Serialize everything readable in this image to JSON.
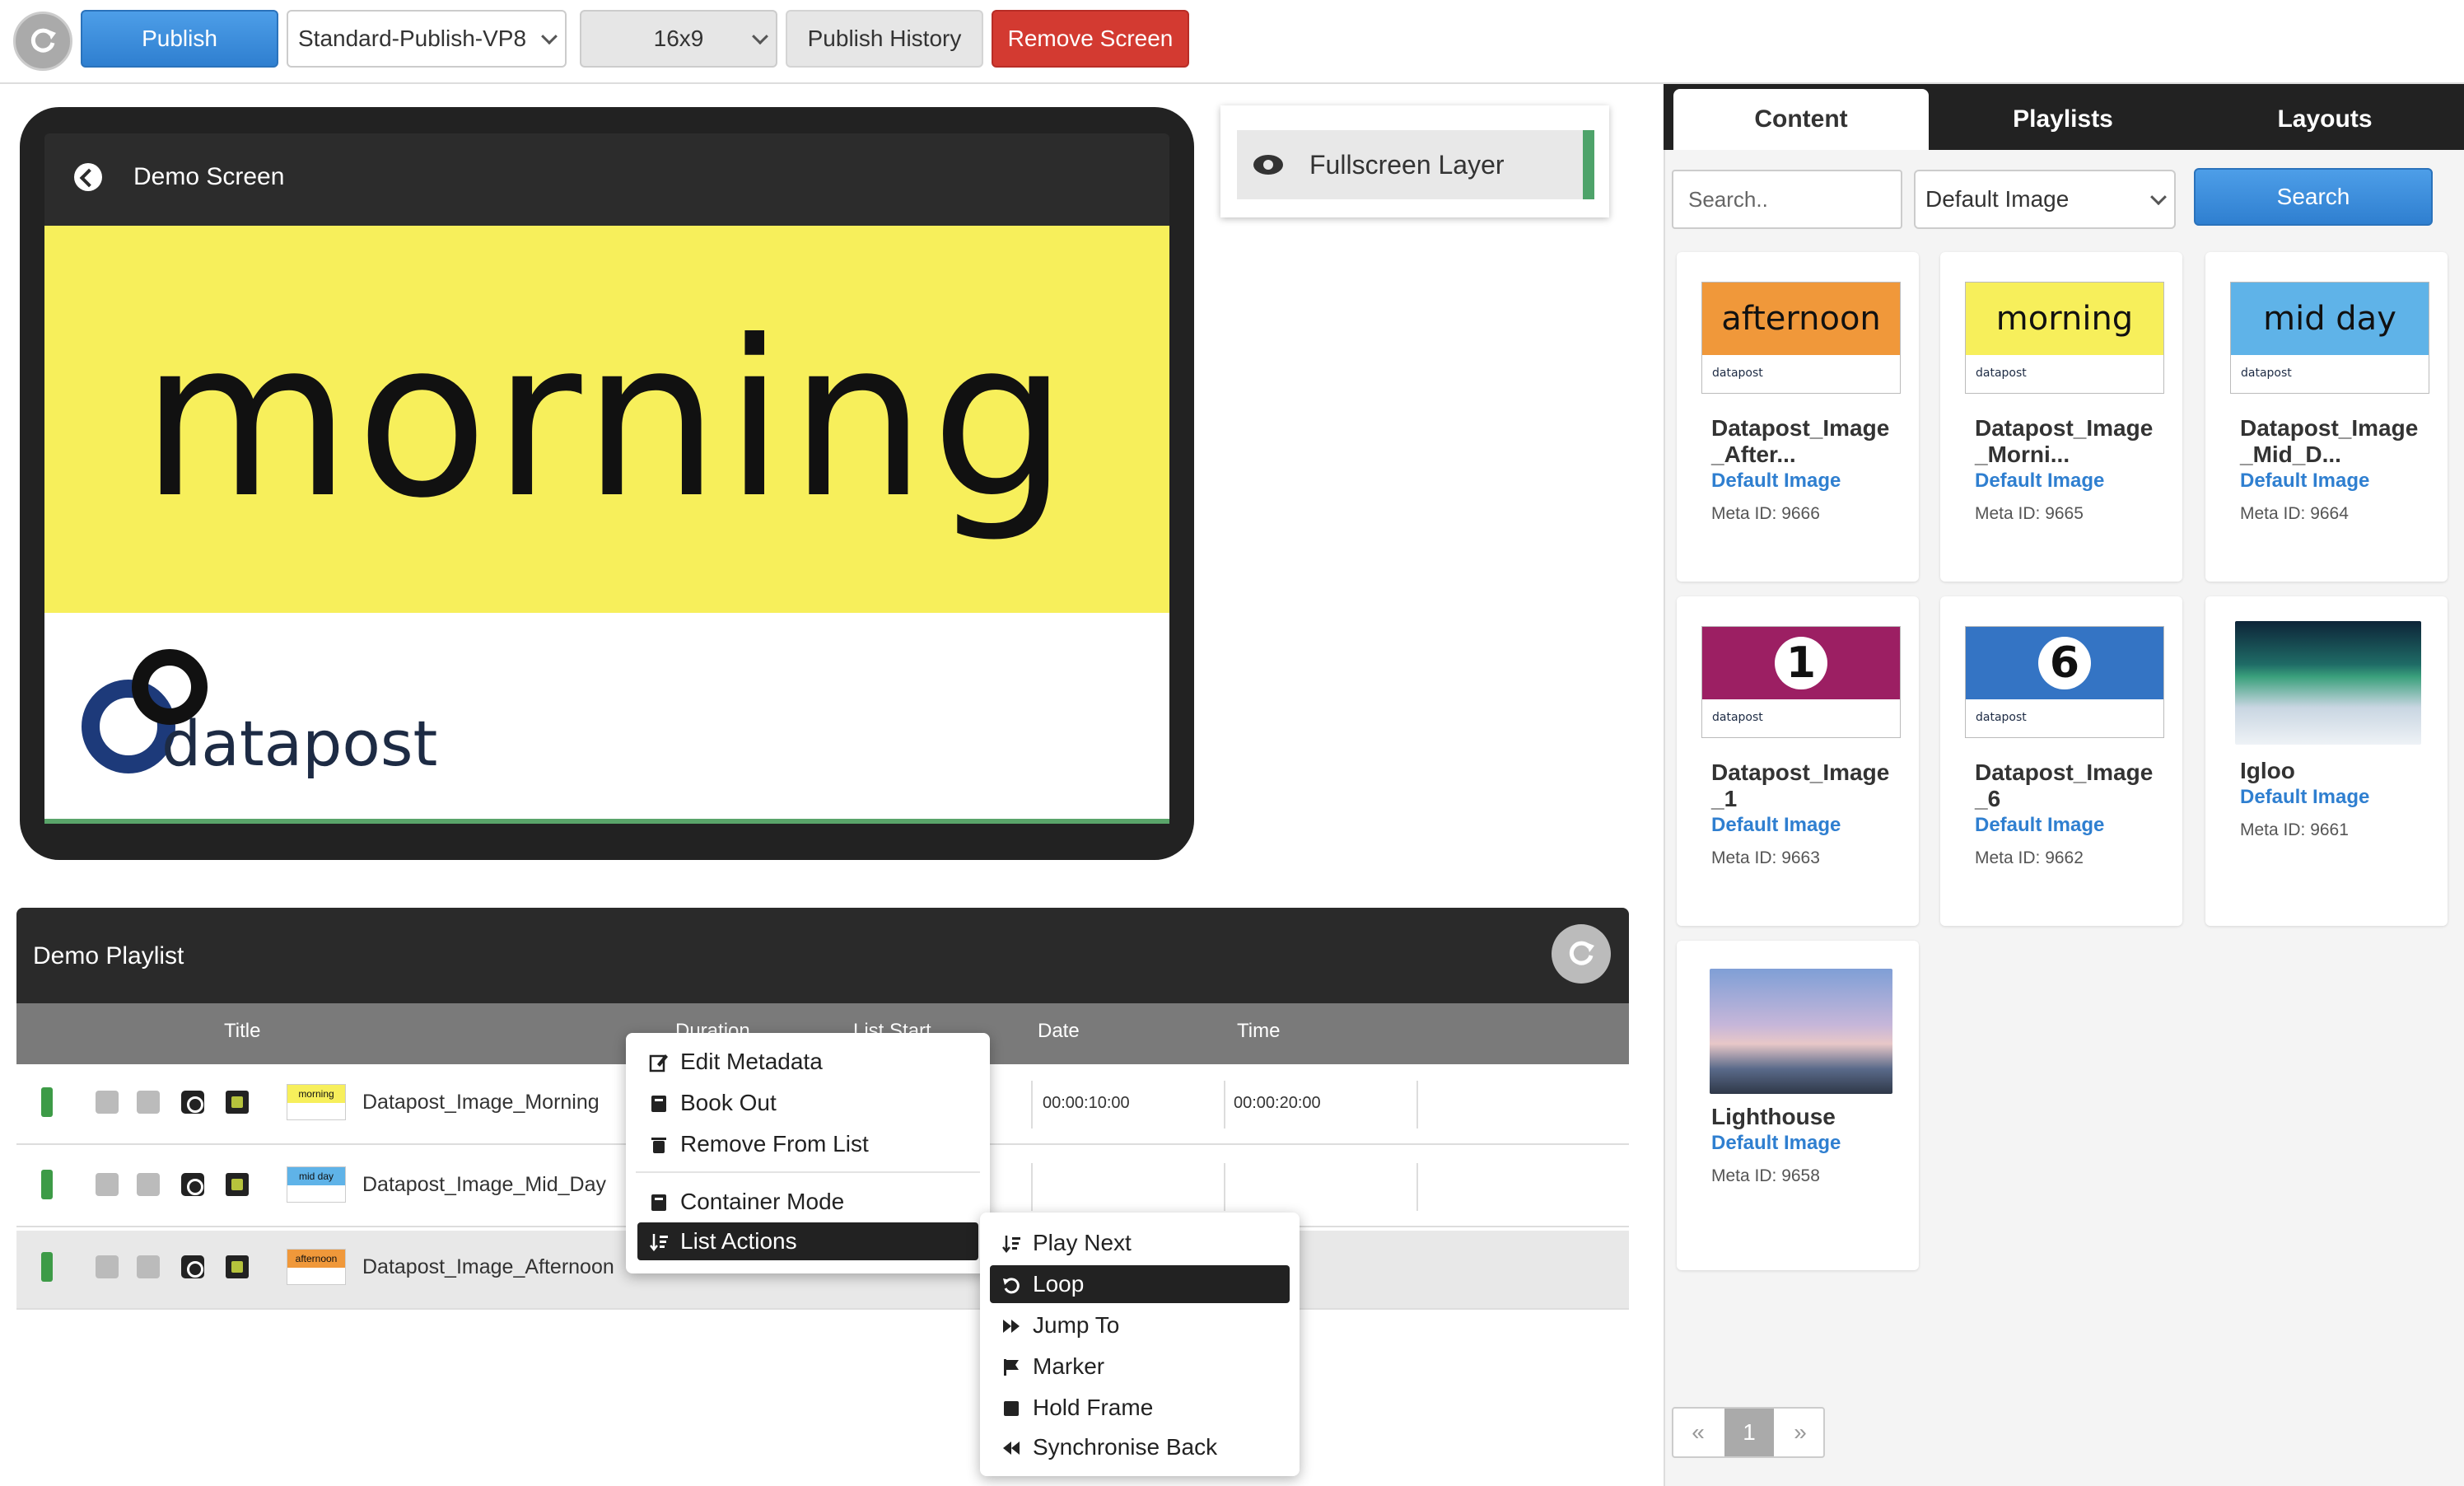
{
  "toolbar": {
    "publish_label": "Publish",
    "profile_value": "Standard-Publish-VP8",
    "ratio_value": "16x9",
    "history_label": "Publish History",
    "remove_label": "Remove Screen"
  },
  "preview": {
    "screen_title": "Demo Screen",
    "content_word": "morning",
    "logo_text": "datapost"
  },
  "layer": {
    "label": "Fullscreen Layer"
  },
  "playlist": {
    "title": "Demo Playlist",
    "columns": [
      "Title",
      "Duration",
      "List Start",
      "Date",
      "Time"
    ],
    "rows": [
      {
        "title": "Datapost_Image_Morning",
        "thumb": "morning",
        "date": "00:00:10:00",
        "time": "00:00:20:00"
      },
      {
        "title": "Datapost_Image_Mid_Day",
        "thumb": "mid day",
        "date": "",
        "time": ""
      },
      {
        "title": "Datapost_Image_Afternoon",
        "thumb": "afternoon",
        "date": "",
        "time": ""
      }
    ]
  },
  "context_menu": {
    "items": [
      "Edit Metadata",
      "Book Out",
      "Remove From List",
      "Container Mode",
      "List Actions"
    ],
    "submenu": [
      "Play Next",
      "Loop",
      "Jump To",
      "Marker",
      "Hold Frame",
      "Synchronise Back"
    ]
  },
  "right_panel": {
    "tabs": [
      "Content",
      "Playlists",
      "Layouts"
    ],
    "search_placeholder": "Search..",
    "filter_value": "Default Image",
    "search_button": "Search",
    "cards": [
      {
        "title": "Datapost_Image _After...",
        "type": "Default Image",
        "meta": "Meta ID: 9666",
        "thumb_text": "afternoon",
        "color": "#f0983a"
      },
      {
        "title": "Datapost_Image _Morni...",
        "type": "Default Image",
        "meta": "Meta ID: 9665",
        "thumb_text": "morning",
        "color": "#f7ef5b"
      },
      {
        "title": "Datapost_Image _Mid_D...",
        "type": "Default Image",
        "meta": "Meta ID: 9664",
        "thumb_text": "mid day",
        "color": "#5fb3e8"
      },
      {
        "title": "Datapost_Image _1",
        "type": "Default Image",
        "meta": "Meta ID: 9663",
        "thumb_text": "1",
        "color": "#9c1f63"
      },
      {
        "title": "Datapost_Image _6",
        "type": "Default Image",
        "meta": "Meta ID: 9662",
        "thumb_text": "6",
        "color": "#3474c4"
      },
      {
        "title": "Igloo",
        "type": "Default Image",
        "meta": "Meta ID: 9661",
        "thumb_text": "",
        "color": "#2d4a66"
      },
      {
        "title": "Lighthouse",
        "type": "Default Image",
        "meta": "Meta ID: 9658",
        "thumb_text": "",
        "color": "#8ea6d8"
      }
    ],
    "logo_small": "datapost",
    "pager": {
      "prev": "«",
      "page": "1",
      "next": "»"
    }
  }
}
